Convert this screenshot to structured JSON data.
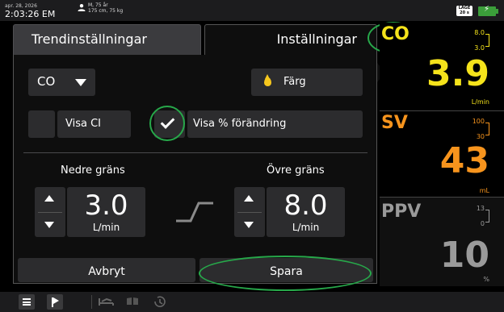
{
  "status": {
    "date": "apr. 28, 2026",
    "time": "2:03:26 EM",
    "patient_line1": "M, 75 år",
    "patient_line2": "175 cm, 75 kg",
    "mode_badge_line1": "LAGE",
    "mode_badge_line2": "20 s",
    "battery_color": "#3b9e3a"
  },
  "tabs": {
    "trend": "Trendinställningar",
    "settings": "Inställningar"
  },
  "settings": {
    "parameter": "CO",
    "color_button": "Färg",
    "show_ci": "Visa CI",
    "show_pct_change": "Visa % förändring",
    "lower_label": "Nedre gräns",
    "upper_label": "Övre gräns",
    "lower_value": "3.0",
    "upper_value": "8.0",
    "unit": "L/min",
    "show_ci_checked": false,
    "show_pct_checked": true
  },
  "actions": {
    "cancel": "Avbryt",
    "save": "Spara"
  },
  "tiles": [
    {
      "name": "CO",
      "high": "8.0",
      "low": "3.0",
      "value": "3.9",
      "unit": "L/min",
      "color": "#f5e31b"
    },
    {
      "name": "SV",
      "high": "100",
      "low": "30",
      "value": "43",
      "unit": "mL",
      "color": "#f7941d"
    },
    {
      "name": "PPV",
      "high": "13",
      "low": "0",
      "value": "10",
      "unit": "%",
      "color": "#9a9a9a"
    }
  ],
  "colors": {
    "highlight": "#27a84a",
    "color_drop": "#f7c81e"
  }
}
